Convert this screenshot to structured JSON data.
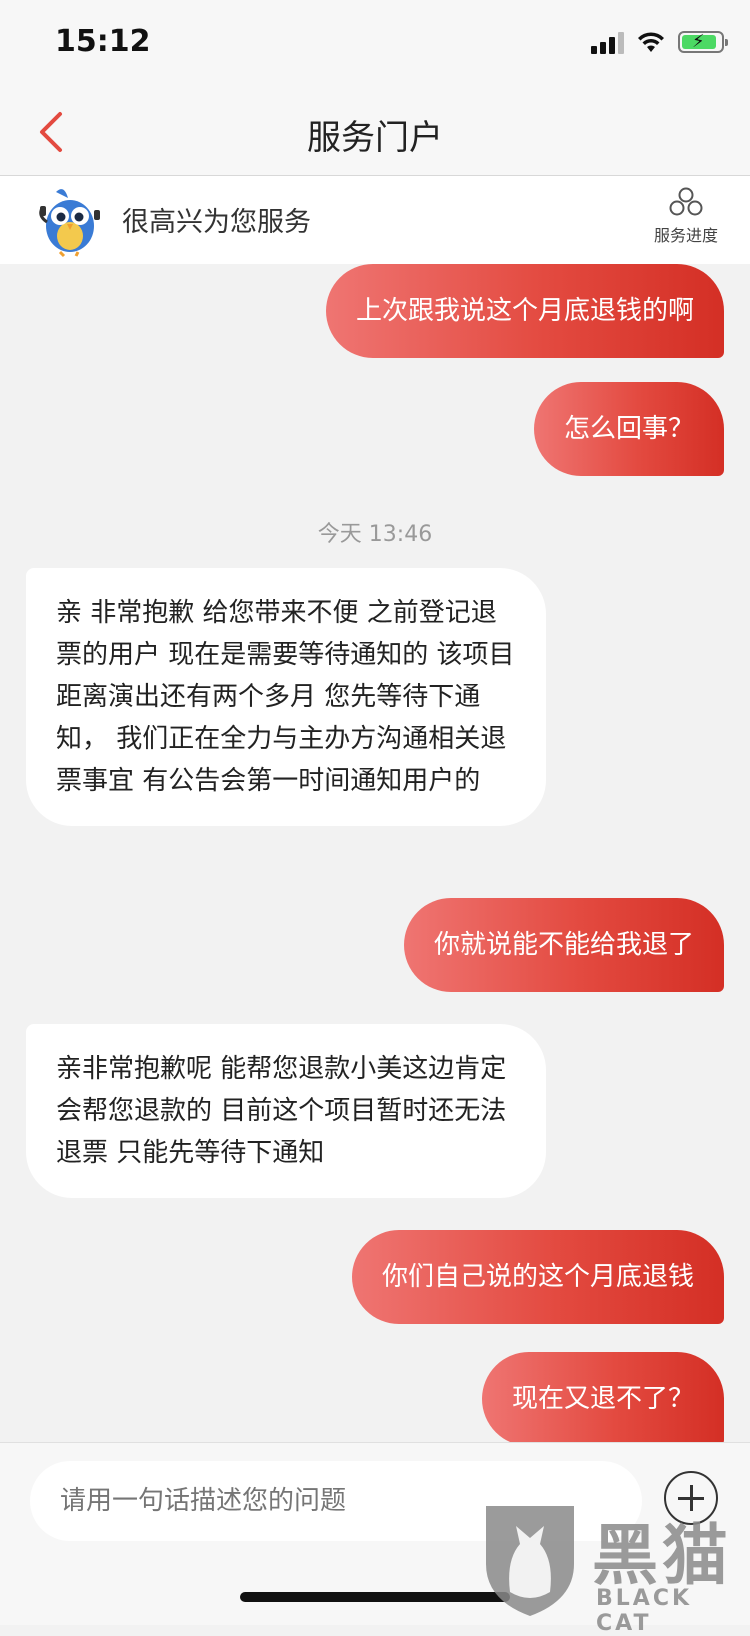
{
  "status_bar": {
    "time": "15:12"
  },
  "nav": {
    "title": "服务门户"
  },
  "service": {
    "greeting": "很高兴为您服务",
    "progress_label": "服务进度"
  },
  "chat": {
    "messages": [
      {
        "from": "me",
        "text": "上次跟我说这个月底退钱的啊"
      },
      {
        "from": "me",
        "text": "怎么回事？"
      },
      {
        "from": "system",
        "text": "今天 13:46"
      },
      {
        "from": "agent",
        "text": "亲 非常抱歉 给您带来不便 之前登记退票的用户 现在是需要等待通知的 该项目距离演出还有两个多月 您先等待下通知， 我们正在全力与主办方沟通相关退票事宜 有公告会第一时间通知用户的"
      },
      {
        "from": "me",
        "text": "你就说能不能给我退了"
      },
      {
        "from": "agent",
        "text": "亲非常抱歉呢  能帮您退款小美这边肯定会帮您退款的 目前这个项目暂时还无法退票 只能先等待下通知"
      },
      {
        "from": "me",
        "text": "你们自己说的这个月底退钱"
      },
      {
        "from": "me",
        "text": "现在又退不了？"
      }
    ]
  },
  "input": {
    "placeholder": "请用一句话描述您的问题"
  },
  "watermark": {
    "cn": "黑猫",
    "en": "BLACK CAT"
  },
  "colors": {
    "accent": "#e34a40",
    "accent_light": "#ef7572",
    "accent_dark": "#d42f25"
  }
}
